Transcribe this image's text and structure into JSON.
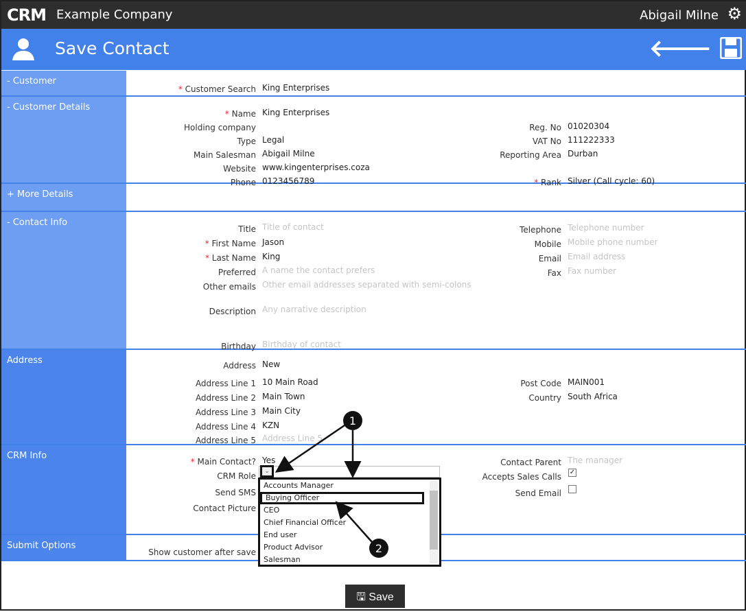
{
  "topbar": {
    "logo": "CRM",
    "company": "Example Company",
    "user": "Abigail Milne"
  },
  "header": {
    "title": "Save Contact"
  },
  "sections": [
    {
      "id": "customer",
      "title": "- Customer",
      "left": [
        {
          "label": "Customer Search",
          "value": "King Enterprises",
          "required": true
        }
      ],
      "right": []
    },
    {
      "id": "details",
      "title": "- Customer Details",
      "left": [
        {
          "label": "Name",
          "value": "King Enterprises",
          "required": true
        },
        {
          "label": "Holding company",
          "value": ""
        },
        {
          "label": "Type",
          "value": "Legal"
        },
        {
          "label": "Main Salesman",
          "value": "Abigail Milne"
        },
        {
          "label": "Website",
          "value": "www.kingenterprises.coza"
        },
        {
          "label": "Phone",
          "value": "0123456789"
        }
      ],
      "right": [
        {
          "label": "Reg. No",
          "value": "01020304"
        },
        {
          "label": "VAT No",
          "value": "111222333"
        },
        {
          "label": "Reporting Area",
          "value": "Durban"
        },
        {
          "label": "Rank",
          "value": "Silver (Call cycle: 60)",
          "required": true
        }
      ]
    },
    {
      "id": "more",
      "title": "+ More Details",
      "left": [],
      "right": []
    },
    {
      "id": "contact",
      "title": "- Contact Info",
      "left": [
        {
          "label": "Title",
          "value": "Title of contact",
          "placeholder": true
        },
        {
          "label": "First Name",
          "value": "Jason",
          "required": true
        },
        {
          "label": "Last Name",
          "value": "King",
          "required": true
        },
        {
          "label": "Preferred",
          "value": "A name the contact prefers",
          "placeholder": true
        },
        {
          "label": "Other emails",
          "value": "Other email addresses separated with semi-colons",
          "placeholder": true
        },
        {
          "label": "Description",
          "value": "Any narrative description",
          "placeholder": true
        },
        {
          "label": "Birthday",
          "value": "Birthday of contact",
          "placeholder": true
        }
      ],
      "right": [
        {
          "label": "Telephone",
          "value": "Telephone number",
          "placeholder": true
        },
        {
          "label": "Mobile",
          "value": "Mobile phone number",
          "placeholder": true
        },
        {
          "label": "Email",
          "value": "Email address",
          "placeholder": true
        },
        {
          "label": "Fax",
          "value": "Fax number",
          "placeholder": true
        }
      ]
    },
    {
      "id": "address",
      "title": "Address",
      "left": [
        {
          "label": "Address",
          "value": "New"
        },
        {
          "label": "Address Line 1",
          "value": "10 Main Road"
        },
        {
          "label": "Address Line 2",
          "value": "Main Town"
        },
        {
          "label": "Address Line 3",
          "value": "Main City"
        },
        {
          "label": "Address Line 4",
          "value": "KZN"
        },
        {
          "label": "Address Line 5",
          "value": "Address Line 5",
          "placeholder": true
        }
      ],
      "right": [
        {
          "label": "Post Code",
          "value": "MAIN001"
        },
        {
          "label": "Country",
          "value": "South Africa"
        }
      ]
    },
    {
      "id": "crm",
      "title": "CRM Info",
      "left": [
        {
          "label": "Main Contact?",
          "value": "Yes",
          "required": true
        },
        {
          "label": "CRM Role",
          "value": ""
        },
        {
          "label": "Send SMS",
          "value": ""
        },
        {
          "label": "Contact Picture",
          "value": ""
        }
      ],
      "right": [
        {
          "label": "Contact Parent",
          "value": "The manager",
          "placeholder": true
        },
        {
          "label": "Accepts Sales Calls",
          "value": ""
        },
        {
          "label": "Send Email",
          "value": ""
        }
      ]
    },
    {
      "id": "submit",
      "title": "Submit Options",
      "left": [
        {
          "label": "Show customer after save",
          "value": ""
        }
      ],
      "right": []
    }
  ],
  "crm_role_options": [
    "Accounts Manager",
    "Buying Officer",
    "CEO",
    "Chief Financial Officer",
    "End user",
    "Product Advisor",
    "Salesman"
  ],
  "checkboxes": {
    "accepts_sales_calls": true,
    "send_email": false
  },
  "annotations": [
    "1",
    "2"
  ],
  "save_button": "Save"
}
